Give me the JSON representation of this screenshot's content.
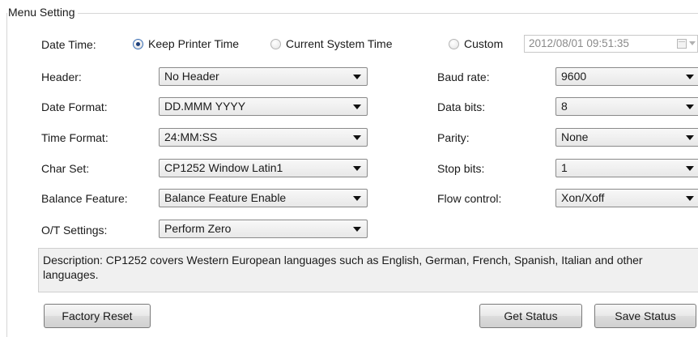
{
  "group": {
    "title": "Menu Setting"
  },
  "datetime": {
    "label": "Date Time:",
    "options": [
      "Keep Printer Time",
      "Current System Time",
      "Custom"
    ],
    "selected": "Keep Printer Time",
    "custom_value": "2012/08/01 09:51:35"
  },
  "left_fields": [
    {
      "label": "Header:",
      "value": "No Header"
    },
    {
      "label": "Date Format:",
      "value": "DD.MMM YYYY"
    },
    {
      "label": "Time Format:",
      "value": "24:MM:SS"
    },
    {
      "label": "Char Set:",
      "value": "CP1252 Window Latin1"
    },
    {
      "label": "Balance Feature:",
      "value": "Balance Feature Enable"
    },
    {
      "label": "O/T Settings:",
      "value": "Perform Zero"
    }
  ],
  "right_fields": [
    {
      "label": "Baud rate:",
      "value": "9600"
    },
    {
      "label": "Data bits:",
      "value": "8"
    },
    {
      "label": "Parity:",
      "value": "None"
    },
    {
      "label": "Stop bits:",
      "value": "1"
    },
    {
      "label": "Flow control:",
      "value": "Xon/Xoff"
    }
  ],
  "description": "Description: CP1252 covers Western European languages such as English, German, French, Spanish, Italian and other languages.",
  "buttons": {
    "factory_reset": "Factory Reset",
    "get_status": "Get Status",
    "save_status": "Save Status"
  }
}
